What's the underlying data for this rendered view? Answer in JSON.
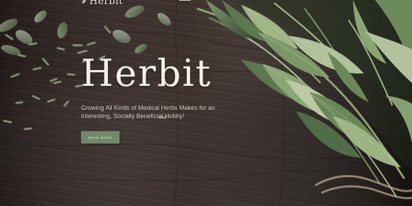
{
  "brand": {
    "name": "Herbit",
    "icon": "leaf-icon"
  },
  "hero": {
    "title": "Herbit",
    "subtitle": "Growing All Kinds of Medical Herbs Makes for an Interesting, Socially Beneficial Hobby!",
    "button_label": "READ MORE"
  },
  "colors": {
    "accent": "#6e8a68",
    "text": "#f4f1ea",
    "background": "#342824"
  }
}
